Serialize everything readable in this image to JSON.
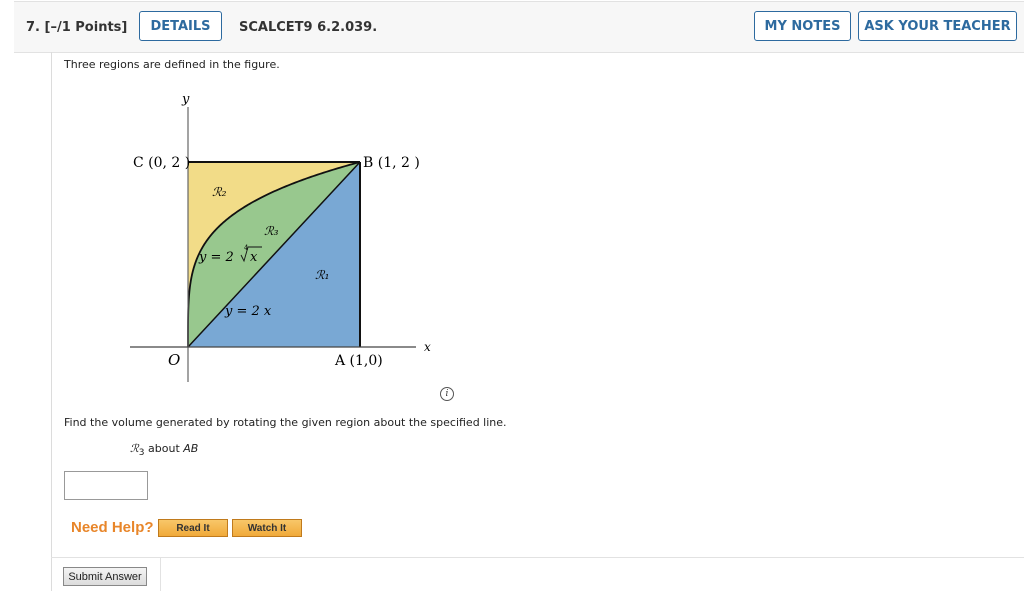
{
  "header": {
    "question_number": "7.",
    "points": "[–/1 Points]",
    "details_label": "DETAILS",
    "problem_code": "SCALCET9 6.2.039.",
    "my_notes_label": "MY NOTES",
    "ask_teacher_label": "ASK YOUR TEACHER"
  },
  "question": {
    "intro": "Three regions are defined in the figure.",
    "prompt": "Find the volume generated by rotating the given region about the specified line.",
    "region_symbol": "ℛ",
    "region_index": "3",
    "region_about": "about",
    "axis_line": "AB"
  },
  "figure": {
    "y_axis_label": "y",
    "x_axis_label": "x",
    "origin_label": "O",
    "point_a": "A (1,0)",
    "point_b": "B (1, 2 )",
    "point_c": "C (0, 2 )",
    "region_1": "ℛ₁",
    "region_2": "ℛ₂",
    "region_3": "ℛ₃",
    "curve_label_prefix": "y = 2 ",
    "curve_root_index": "4",
    "curve_root_radicand": "x",
    "line_label": "y = 2 x",
    "colors": {
      "region_1": "#79a8d4",
      "region_2": "#f2dc88",
      "region_3": "#98c88e"
    }
  },
  "answer": {
    "value": ""
  },
  "help": {
    "label": "Need Help?",
    "read_it": "Read It",
    "watch_it": "Watch It"
  },
  "submit_label": "Submit Answer",
  "info_icon_glyph": "i"
}
